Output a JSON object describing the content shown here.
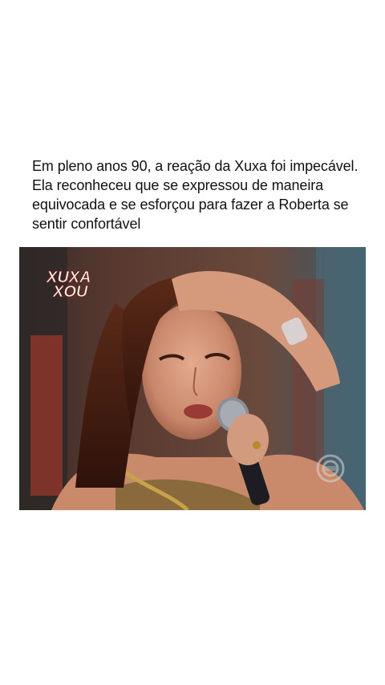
{
  "post": {
    "caption_lines": [
      "Em pleno anos 90, a reação da Xuxa foi impecável.",
      "Ela reconheceu que se expressou de maneira",
      "equivocada e se esforçou para fazer a Roberta se",
      "sentir confortável"
    ]
  },
  "video": {
    "logo_line1": "XUXA",
    "logo_line2": "XOU"
  }
}
